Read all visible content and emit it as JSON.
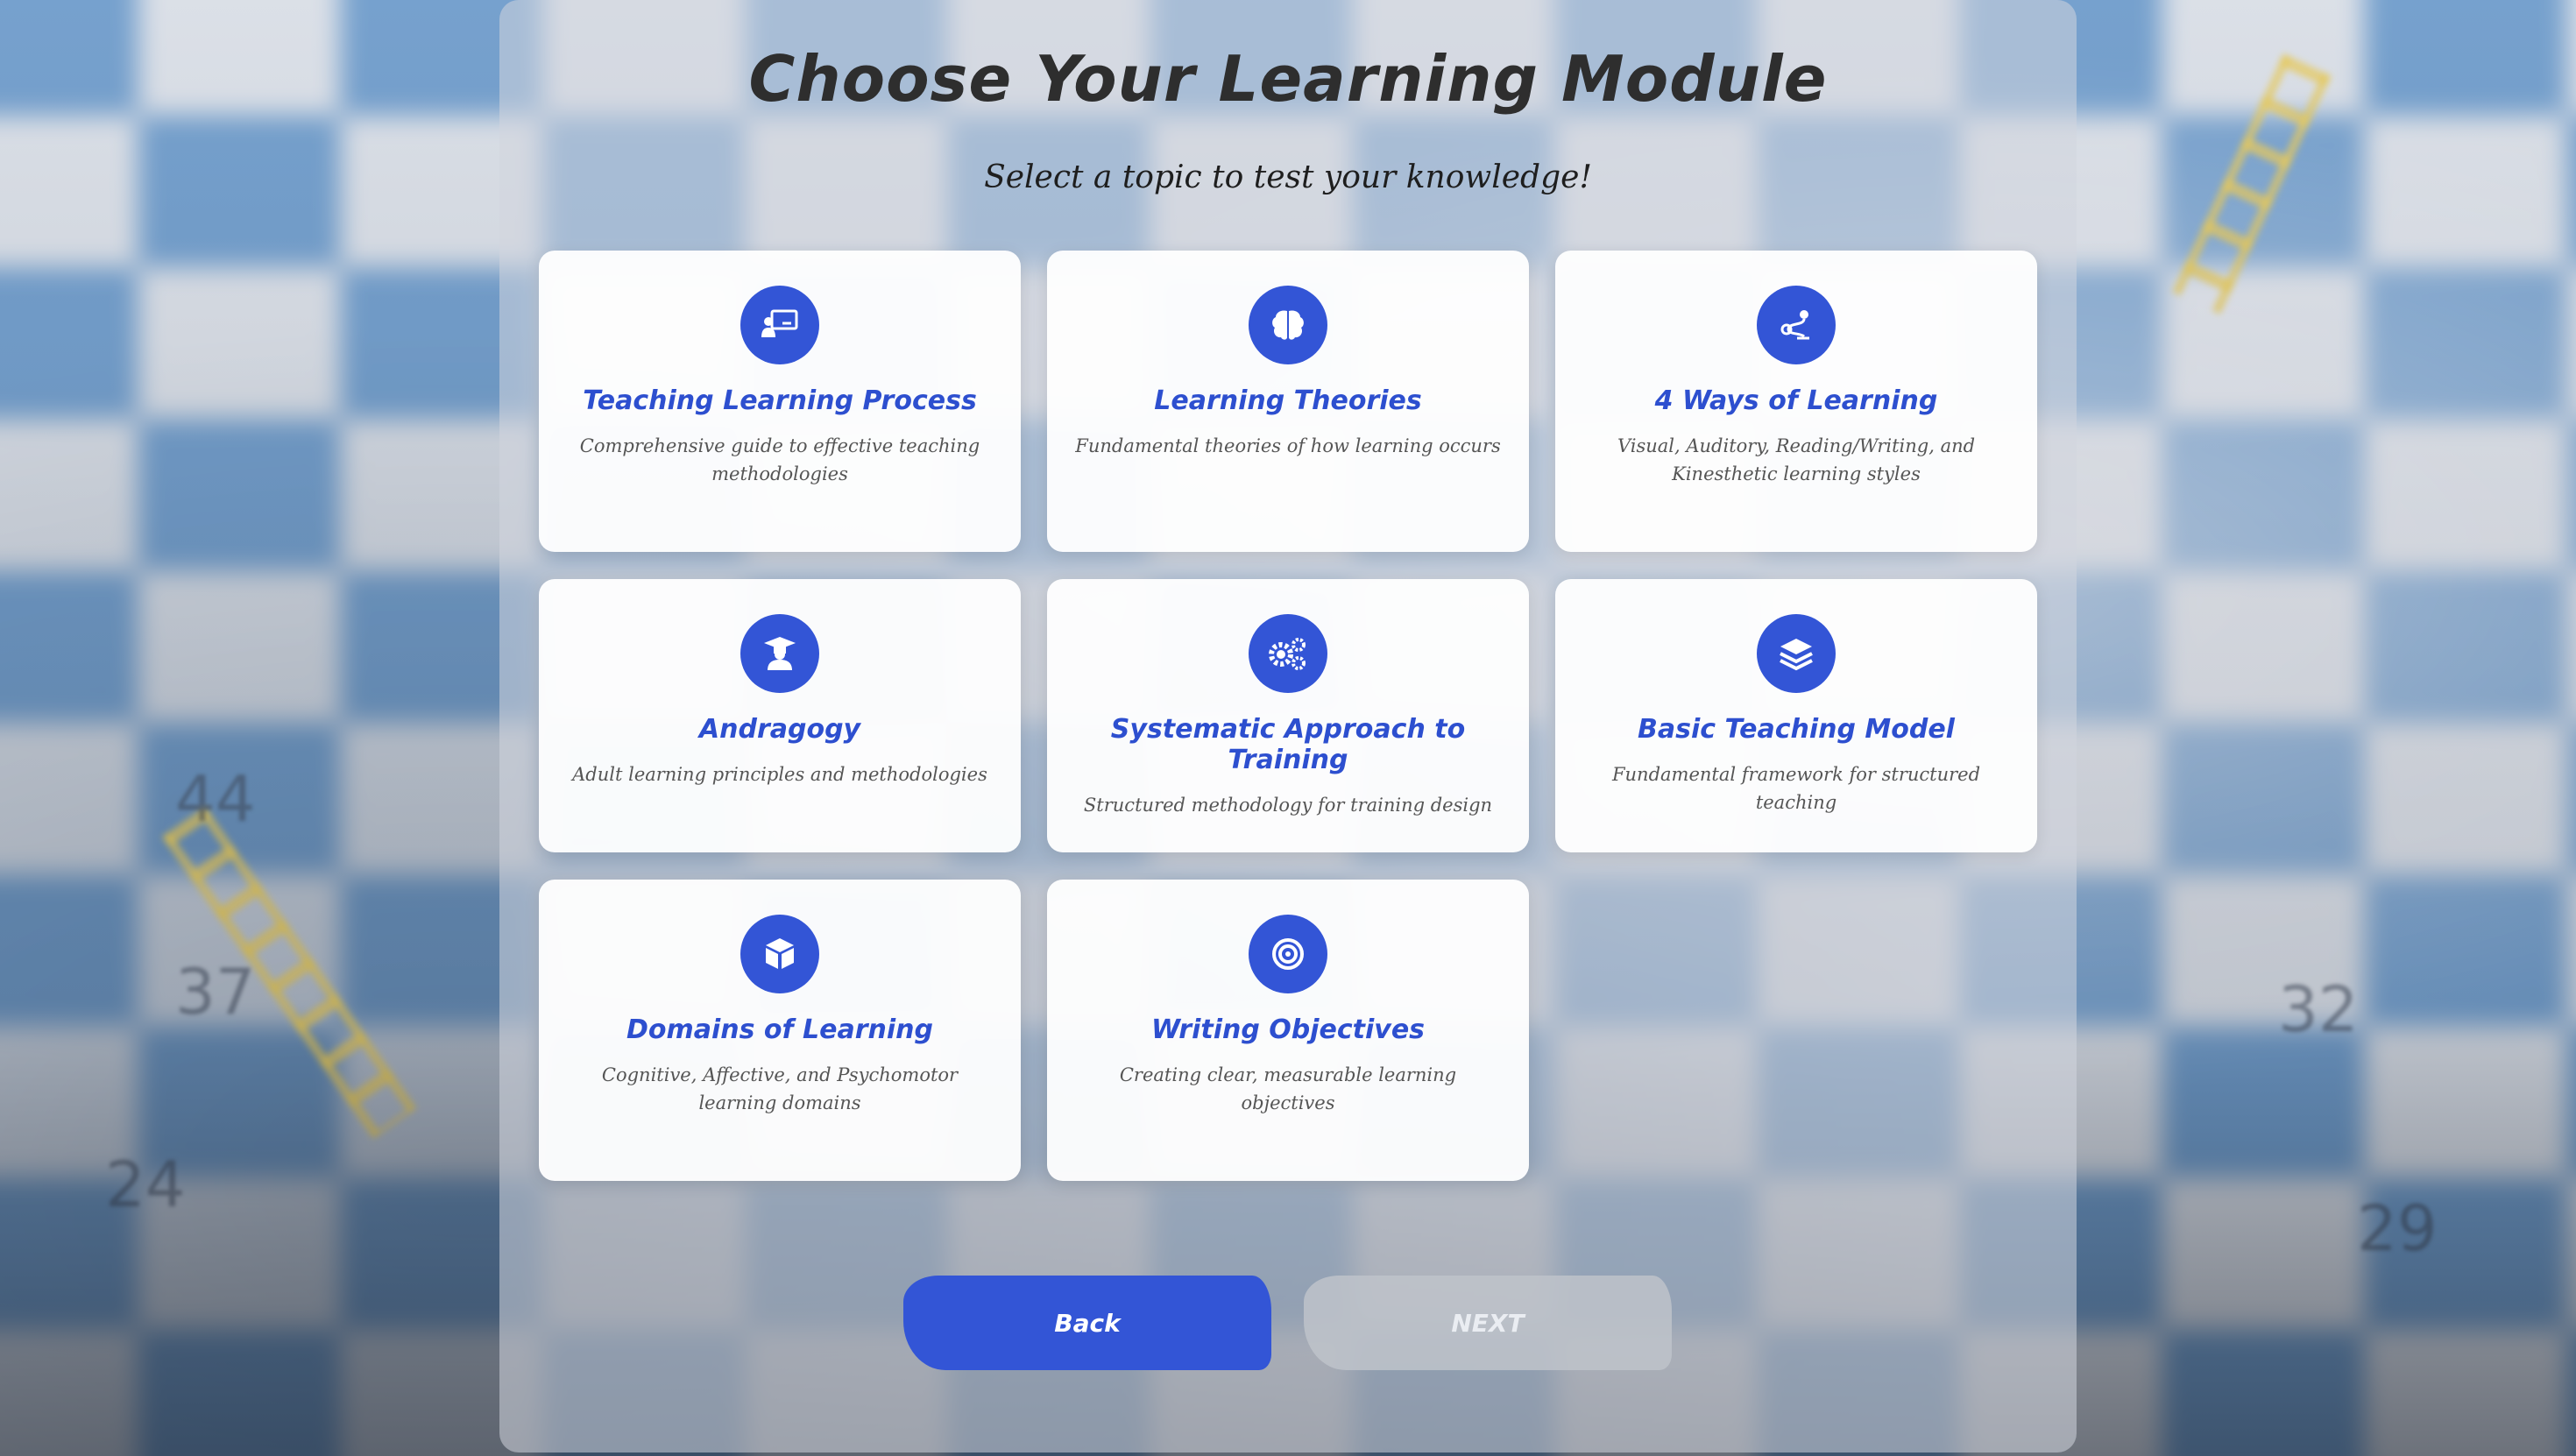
{
  "header": {
    "title": "Choose Your Learning Module",
    "subtitle": "Select a topic to test your knowledge!"
  },
  "modules": [
    {
      "icon": "teacher-board-icon",
      "title": "Teaching Learning Process",
      "description": "Comprehensive guide to effective teaching methodologies"
    },
    {
      "icon": "brain-icon",
      "title": "Learning Theories",
      "description": "Fundamental theories of how learning occurs"
    },
    {
      "icon": "route-icon",
      "title": "4 Ways of Learning",
      "description": "Visual, Auditory, Reading/Writing, and Kinesthetic learning styles"
    },
    {
      "icon": "graduate-icon",
      "title": "Andragogy",
      "description": "Adult learning principles and methodologies"
    },
    {
      "icon": "gears-icon",
      "title": "Systematic Approach to Training",
      "description": "Structured methodology for training design"
    },
    {
      "icon": "layers-icon",
      "title": "Basic Teaching Model",
      "description": "Fundamental framework for structured teaching"
    },
    {
      "icon": "cube-icon",
      "title": "Domains of Learning",
      "description": "Cognitive, Affective, and Psychomotor learning domains"
    },
    {
      "icon": "target-icon",
      "title": "Writing Objectives",
      "description": "Creating clear, measurable learning objectives"
    }
  ],
  "navigation": {
    "back_label": "Back",
    "next_label": "NEXT"
  },
  "colors": {
    "accent": "#3355d6",
    "card_title": "#2d4fcf",
    "disabled_button": "#bec3ca"
  }
}
